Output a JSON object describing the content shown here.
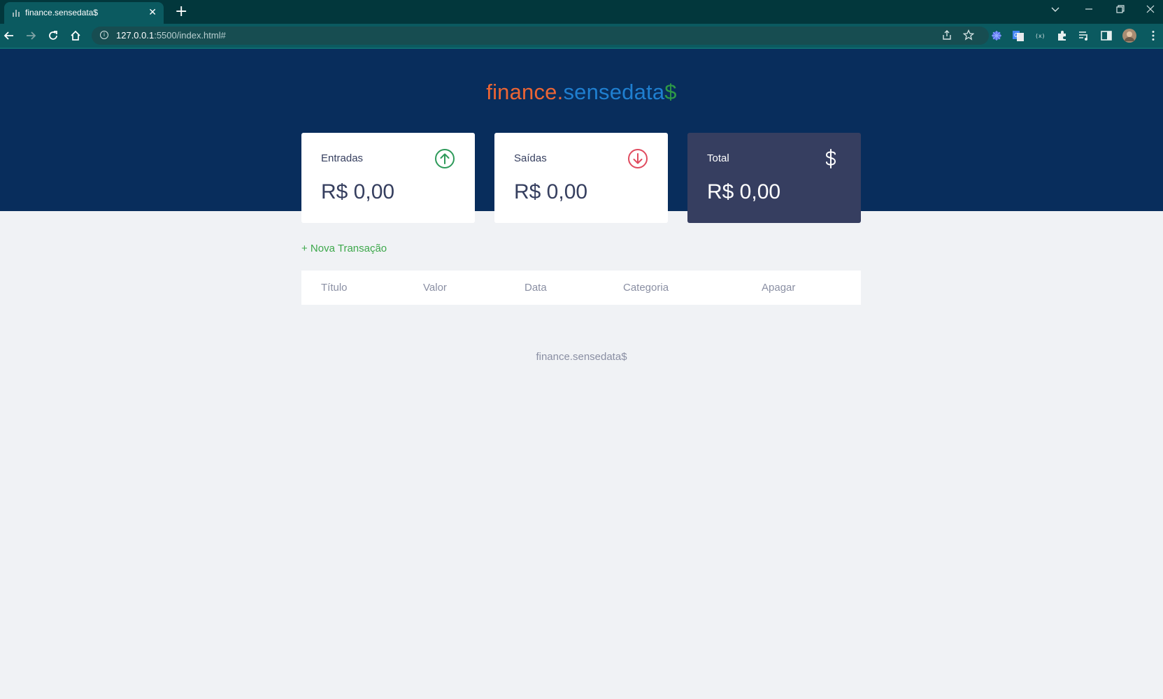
{
  "browser": {
    "tab_title": "finance.sensedata$",
    "new_tab_symbol": "+",
    "tab_close_symbol": "✕",
    "url_host": "127.0.0.1",
    "url_rest": ":5500/index.html#",
    "icons": [
      "back-icon",
      "forward-icon",
      "reload-icon",
      "home-icon",
      "site-info-icon",
      "share-icon",
      "bookmark-star-icon",
      "extension-icon",
      "translate-icon",
      "puzzle-icon",
      "media-queue-icon",
      "side-panel-icon",
      "profile-avatar",
      "more-menu-icon",
      "tab-search-icon",
      "minimize-icon",
      "restore-icon",
      "close-window-icon"
    ]
  },
  "logo": {
    "part1": "finance.",
    "part2": "sensedata",
    "part3": "$"
  },
  "cards": {
    "income": {
      "label": "Entradas",
      "value": "R$ 0,00"
    },
    "expense": {
      "label": "Saídas",
      "value": "R$ 0,00"
    },
    "total": {
      "label": "Total",
      "value": "R$ 0,00"
    }
  },
  "new_transaction": "+ Nova Transação",
  "table": {
    "headers": [
      "Título",
      "Valor",
      "Data",
      "Categoria",
      "Apagar"
    ]
  },
  "footer": "finance.sensedata$",
  "colors": {
    "header_bg": "#082d5c",
    "page_bg": "#f0f2f5",
    "total_card_bg": "#363e60",
    "income_icon": "#2e9a5a",
    "expense_icon": "#e04b5f",
    "link_green": "#3da84b"
  }
}
